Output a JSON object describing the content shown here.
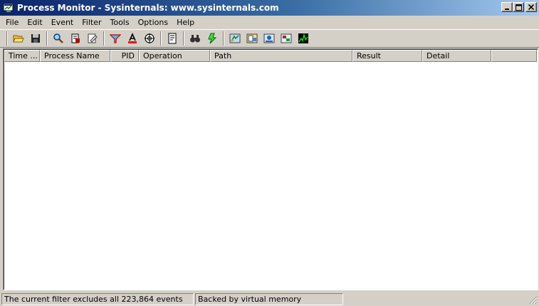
{
  "window": {
    "title": "Process Monitor - Sysinternals: www.sysinternals.com",
    "icon": "procmon-app-icon"
  },
  "menu": [
    "File",
    "Edit",
    "Event",
    "Filter",
    "Tools",
    "Options",
    "Help"
  ],
  "toolbar": {
    "buttons": [
      {
        "name": "open-icon",
        "label": "Open"
      },
      {
        "name": "save-icon",
        "label": "Save"
      },
      {
        "name": "capture-icon",
        "label": "Capture"
      },
      {
        "name": "autoscroll-icon",
        "label": "Autoscroll"
      },
      {
        "name": "clear-icon",
        "label": "Clear"
      },
      {
        "name": "filter-icon",
        "label": "Filter"
      },
      {
        "name": "highlight-icon",
        "label": "Highlight"
      },
      {
        "name": "include-process-icon",
        "label": "Include Process From Window"
      },
      {
        "name": "process-tree-icon",
        "label": "Process Tree"
      },
      {
        "name": "find-icon",
        "label": "Find"
      },
      {
        "name": "jump-icon",
        "label": "Jump To"
      },
      {
        "name": "registry-activity-icon",
        "label": "Show Registry Activity"
      },
      {
        "name": "file-activity-icon",
        "label": "Show File System Activity"
      },
      {
        "name": "network-activity-icon",
        "label": "Show Network Activity"
      },
      {
        "name": "process-activity-icon",
        "label": "Show Process and Thread Activity"
      },
      {
        "name": "profiling-icon",
        "label": "Show Profiling Events"
      }
    ]
  },
  "columns": [
    "Time ...",
    "Process Name",
    "PID",
    "Operation",
    "Path",
    "Result",
    "Detail"
  ],
  "status": {
    "filter": "The current filter excludes all 223,864 events",
    "memory": "Backed by virtual memory"
  },
  "colors": {
    "title_start": "#0a246a",
    "title_end": "#a6caf0",
    "face": "#d4d0c8",
    "list_bg": "#ffffff"
  }
}
